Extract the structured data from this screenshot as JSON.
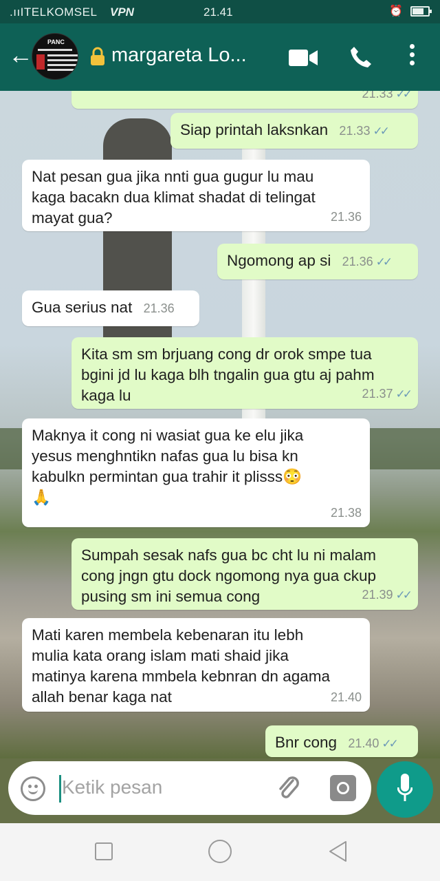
{
  "status_bar": {
    "carrier": ".ııITELKOMSEL",
    "vpn": "VPN",
    "time": "21.41",
    "alarm_icon": "alarm-icon",
    "battery_level": 0.68
  },
  "header": {
    "contact_name": "margareta Lo...",
    "avatar_label": "PANC",
    "icons": [
      "back-arrow-icon",
      "lock-icon",
      "video-call-icon",
      "phone-call-icon",
      "more-vert-icon"
    ]
  },
  "messages": [
    {
      "dir": "out",
      "text": "",
      "time": "21.33",
      "ticks": "✓✓"
    },
    {
      "dir": "out",
      "text": "Siap printah laksnkan",
      "time": "21.33",
      "ticks": "✓✓"
    },
    {
      "dir": "in",
      "text": "Nat pesan gua jika nnti gua gugur lu mau\nkaga bacakn dua klimat shadat di telingat\nmayat gua?",
      "time": "21.36"
    },
    {
      "dir": "out",
      "text": "Ngomong ap si",
      "time": "21.36",
      "ticks": "✓✓"
    },
    {
      "dir": "in",
      "text": "Gua serius nat",
      "time": "21.36"
    },
    {
      "dir": "out",
      "text": "Kita sm sm brjuang cong dr orok smpe tua\nbgini jd lu kaga blh tngalin gua gtu aj pahm\nkaga lu",
      "time": "21.37",
      "ticks": "✓✓"
    },
    {
      "dir": "in",
      "text": "Maknya it cong ni wasiat gua ke elu jika\nyesus menghntikn nafas gua lu bisa kn\nkabulkn permintan gua trahir it plisss😳\n🙏",
      "time": "21.38"
    },
    {
      "dir": "out",
      "text": "Sumpah sesak nafs gua bc cht lu ni malam\ncong jngn gtu dock ngomong nya gua ckup\npusing sm ini semua cong",
      "time": "21.39",
      "ticks": "✓✓"
    },
    {
      "dir": "in",
      "text": "Mati karen membela kebenaran itu lebh\nmulia kata orang islam mati shaid jika\nmatinya karena mmbela kebnran dn agama\nallah benar kaga nat",
      "time": "21.40"
    },
    {
      "dir": "out",
      "text": "Bnr cong",
      "time": "21.40",
      "ticks": "✓✓"
    }
  ],
  "composer": {
    "placeholder": "Ketik pesan",
    "icons": [
      "emoji-icon",
      "attach-icon",
      "camera-icon",
      "mic-icon"
    ]
  },
  "nav_bar": {
    "icons": [
      "recents-icon",
      "home-icon",
      "back-icon"
    ]
  },
  "colors": {
    "header": "#0e6156",
    "status_bar": "#0f4f45",
    "outgoing_bubble": "#e1fbc7",
    "incoming_bubble": "#ffffff",
    "accent": "#0f9b8a",
    "read_ticks": "#6c9ab8"
  }
}
